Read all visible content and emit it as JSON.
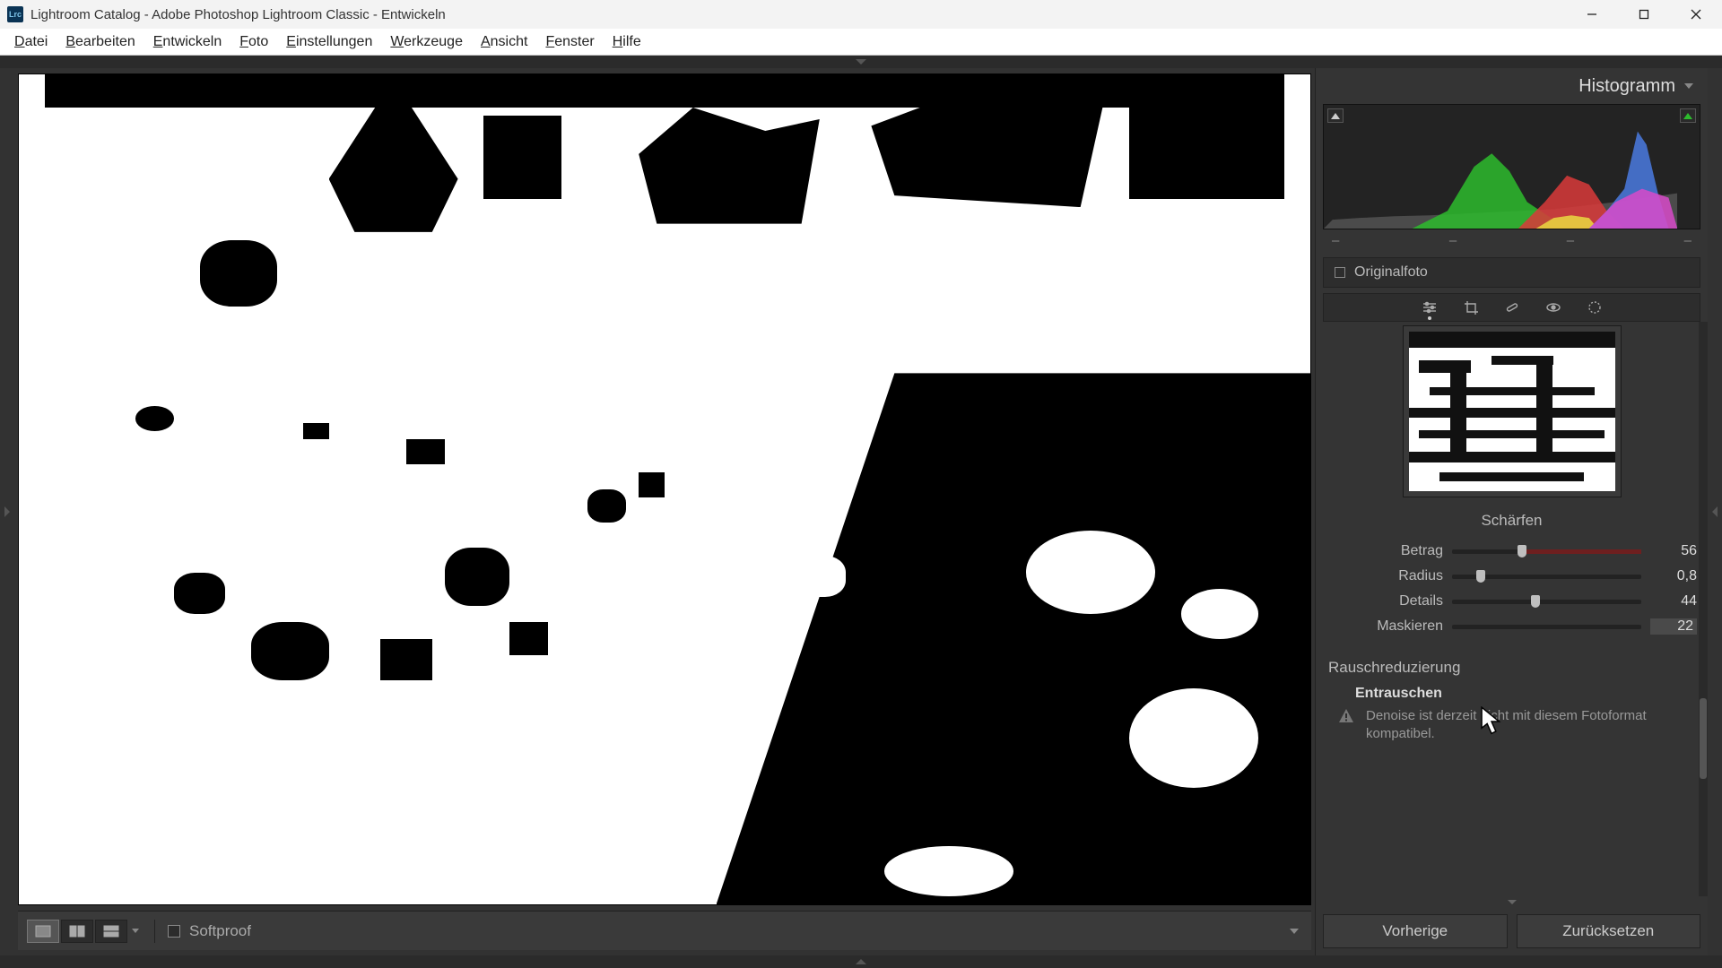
{
  "window": {
    "title": "Lightroom Catalog - Adobe Photoshop Lightroom Classic - Entwickeln",
    "app_abbrev": "Lrc"
  },
  "menu": {
    "items": [
      "Datei",
      "Bearbeiten",
      "Entwickeln",
      "Foto",
      "Einstellungen",
      "Werkzeuge",
      "Ansicht",
      "Fenster",
      "Hilfe"
    ]
  },
  "viewer_toolbar": {
    "softproof_label": "Softproof"
  },
  "right_panel": {
    "histogram_label": "Histogramm",
    "readout": [
      "–",
      "–",
      "–",
      "–"
    ],
    "originalfoto": "Originalfoto",
    "sharpen": {
      "title": "Schärfen",
      "amount_label": "Betrag",
      "amount_value": "56",
      "amount_pct": 37,
      "radius_label": "Radius",
      "radius_value": "0,8",
      "radius_pct": 15,
      "details_label": "Details",
      "details_value": "44",
      "details_pct": 44,
      "masking_label": "Maskieren",
      "masking_value": "22",
      "masking_pct": 22
    },
    "noise": {
      "title": "Rauschreduzierung",
      "denoise_label": "Entrauschen",
      "denoise_warning": "Denoise ist derzeit nicht mit diesem Fotoformat kompatibel."
    },
    "buttons": {
      "previous": "Vorherige",
      "reset": "Zurücksetzen"
    }
  }
}
